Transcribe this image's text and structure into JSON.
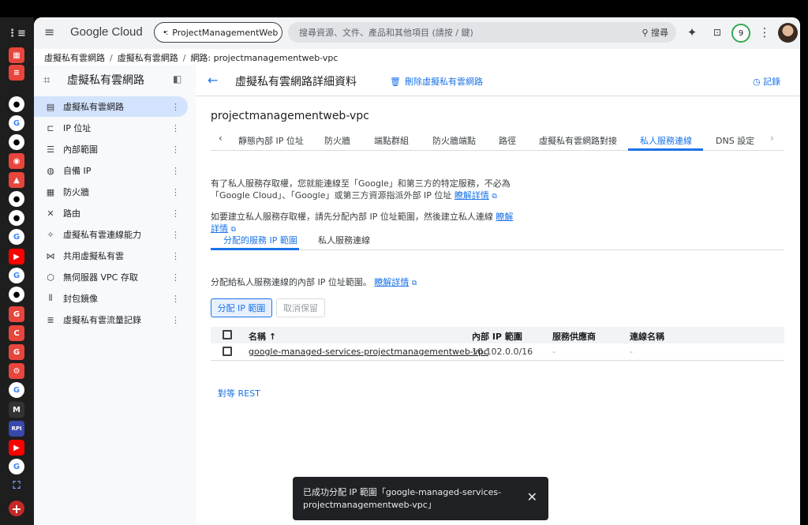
{
  "header": {
    "logo": "Google Cloud",
    "project": "ProjectManagementWeb",
    "search_placeholder": "搜尋資源、文件、產品和其他項目 (請按 / 鍵)",
    "search_button": "搜尋",
    "notification_count": "9"
  },
  "breadcrumb": [
    "虛擬私有雲網路",
    "虛擬私有雲網路",
    "網路: projectmanagementweb-vpc"
  ],
  "sidebar": {
    "title": "虛擬私有雲網路",
    "items": [
      {
        "label": "虛擬私有雲網路",
        "icon": "network-icon"
      },
      {
        "label": "IP 位址",
        "icon": "ip-icon"
      },
      {
        "label": "內部範圍",
        "icon": "range-icon"
      },
      {
        "label": "自備 IP",
        "icon": "globe-icon"
      },
      {
        "label": "防火牆",
        "icon": "firewall-icon"
      },
      {
        "label": "路由",
        "icon": "route-icon"
      },
      {
        "label": "虛擬私有雲連線能力",
        "icon": "connectivity-icon"
      },
      {
        "label": "共用虛擬私有雲",
        "icon": "shared-vpc-icon"
      },
      {
        "label": "無伺服器 VPC 存取",
        "icon": "serverless-icon"
      },
      {
        "label": "封包鏡像",
        "icon": "mirroring-icon"
      },
      {
        "label": "虛擬私有雲流量記錄",
        "icon": "flow-logs-icon"
      }
    ]
  },
  "main": {
    "title": "虛擬私有雲網路詳細資料",
    "delete": "刪除虛擬私有雲網路",
    "log": "記錄",
    "vpc_name": "projectmanagementweb-vpc",
    "tabs": [
      "靜態內部 IP 位址",
      "防火牆",
      "端點群組",
      "防火牆端點",
      "路徑",
      "虛擬私有雲網路對接",
      "私人服務連線",
      "DNS 設定"
    ],
    "para1_a": "有了私人服務存取權，您就能連線至「Google」和第三方的特定服務，不必為",
    "para1_b": "「Google Cloud」、「Google」或第三方資源指派外部 IP 位址",
    "para2_a": "如要建立私人服務存取權，請先分配內部 IP 位址範圍，然後建立私人連線",
    "learn_more": "瞭解",
    "learn_more_2": "詳情",
    "learn_more_full": "瞭解詳情",
    "subtabs": [
      "分配的服務 IP 範圍",
      "私人服務連線"
    ],
    "sub_desc": "分配給私人服務連線的內部 IP 位址範圍。",
    "allocate_button": "分配 IP 範圍",
    "cancel_button": "取消保留",
    "table": {
      "headers": [
        "名稱",
        "內部 IP 範圍",
        "服務供應商",
        "連線名稱"
      ],
      "rows": [
        {
          "name": "google-managed-services-projectmanagementweb-vpc",
          "range": "10.102.0.0/16",
          "provider": "-",
          "connection": "-"
        }
      ]
    },
    "rest": "對等 REST"
  },
  "toast": {
    "line1": "已成功分配 IP 範圍「google-managed-services-",
    "line2": "projectmanagementweb-vpc」"
  },
  "dock": {
    "items": [
      "grid-icon",
      "list-search-icon",
      "github-icon",
      "google-icon",
      "github-icon",
      "globe-icon",
      "drive-icon",
      "github-icon",
      "github-icon",
      "google-icon",
      "youtube-icon",
      "google-icon",
      "github-icon",
      "gmail-icon",
      "c-icon",
      "gmail-icon",
      "settings-icon",
      "google-icon",
      "m-icon",
      "rpi-icon",
      "youtube-icon",
      "google-icon",
      "workflow-icon",
      "add-icon"
    ]
  },
  "colors": {
    "accent": "#1a73e8",
    "active_bg": "#d3e3fd",
    "toast_bg": "#202124"
  }
}
